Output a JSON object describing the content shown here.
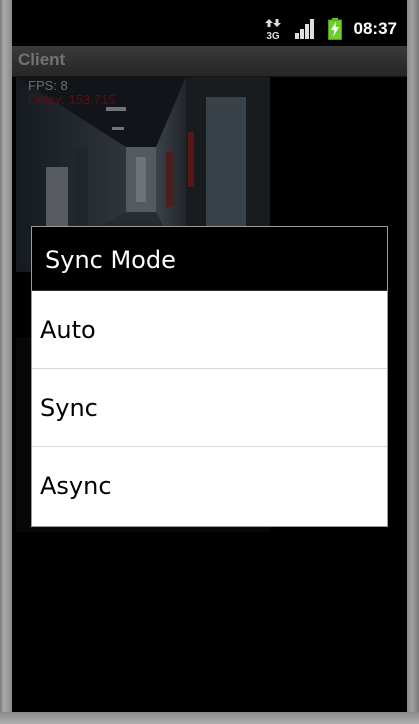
{
  "status_bar": {
    "network_type": "3G",
    "clock": "08:37",
    "icons": [
      "data-arrows-icon",
      "signal-bars-icon",
      "battery-charging-icon"
    ]
  },
  "app": {
    "title": "Client"
  },
  "video": {
    "fps_label": "FPS: 8",
    "delay_label": "Delay: 153.715"
  },
  "dialog": {
    "title": "Sync Mode",
    "options": [
      {
        "label": "Auto"
      },
      {
        "label": "Sync"
      },
      {
        "label": "Async"
      }
    ]
  },
  "colors": {
    "delay_text": "#b41414",
    "battery": "#6ccf2f",
    "title_bar": "#575757"
  }
}
